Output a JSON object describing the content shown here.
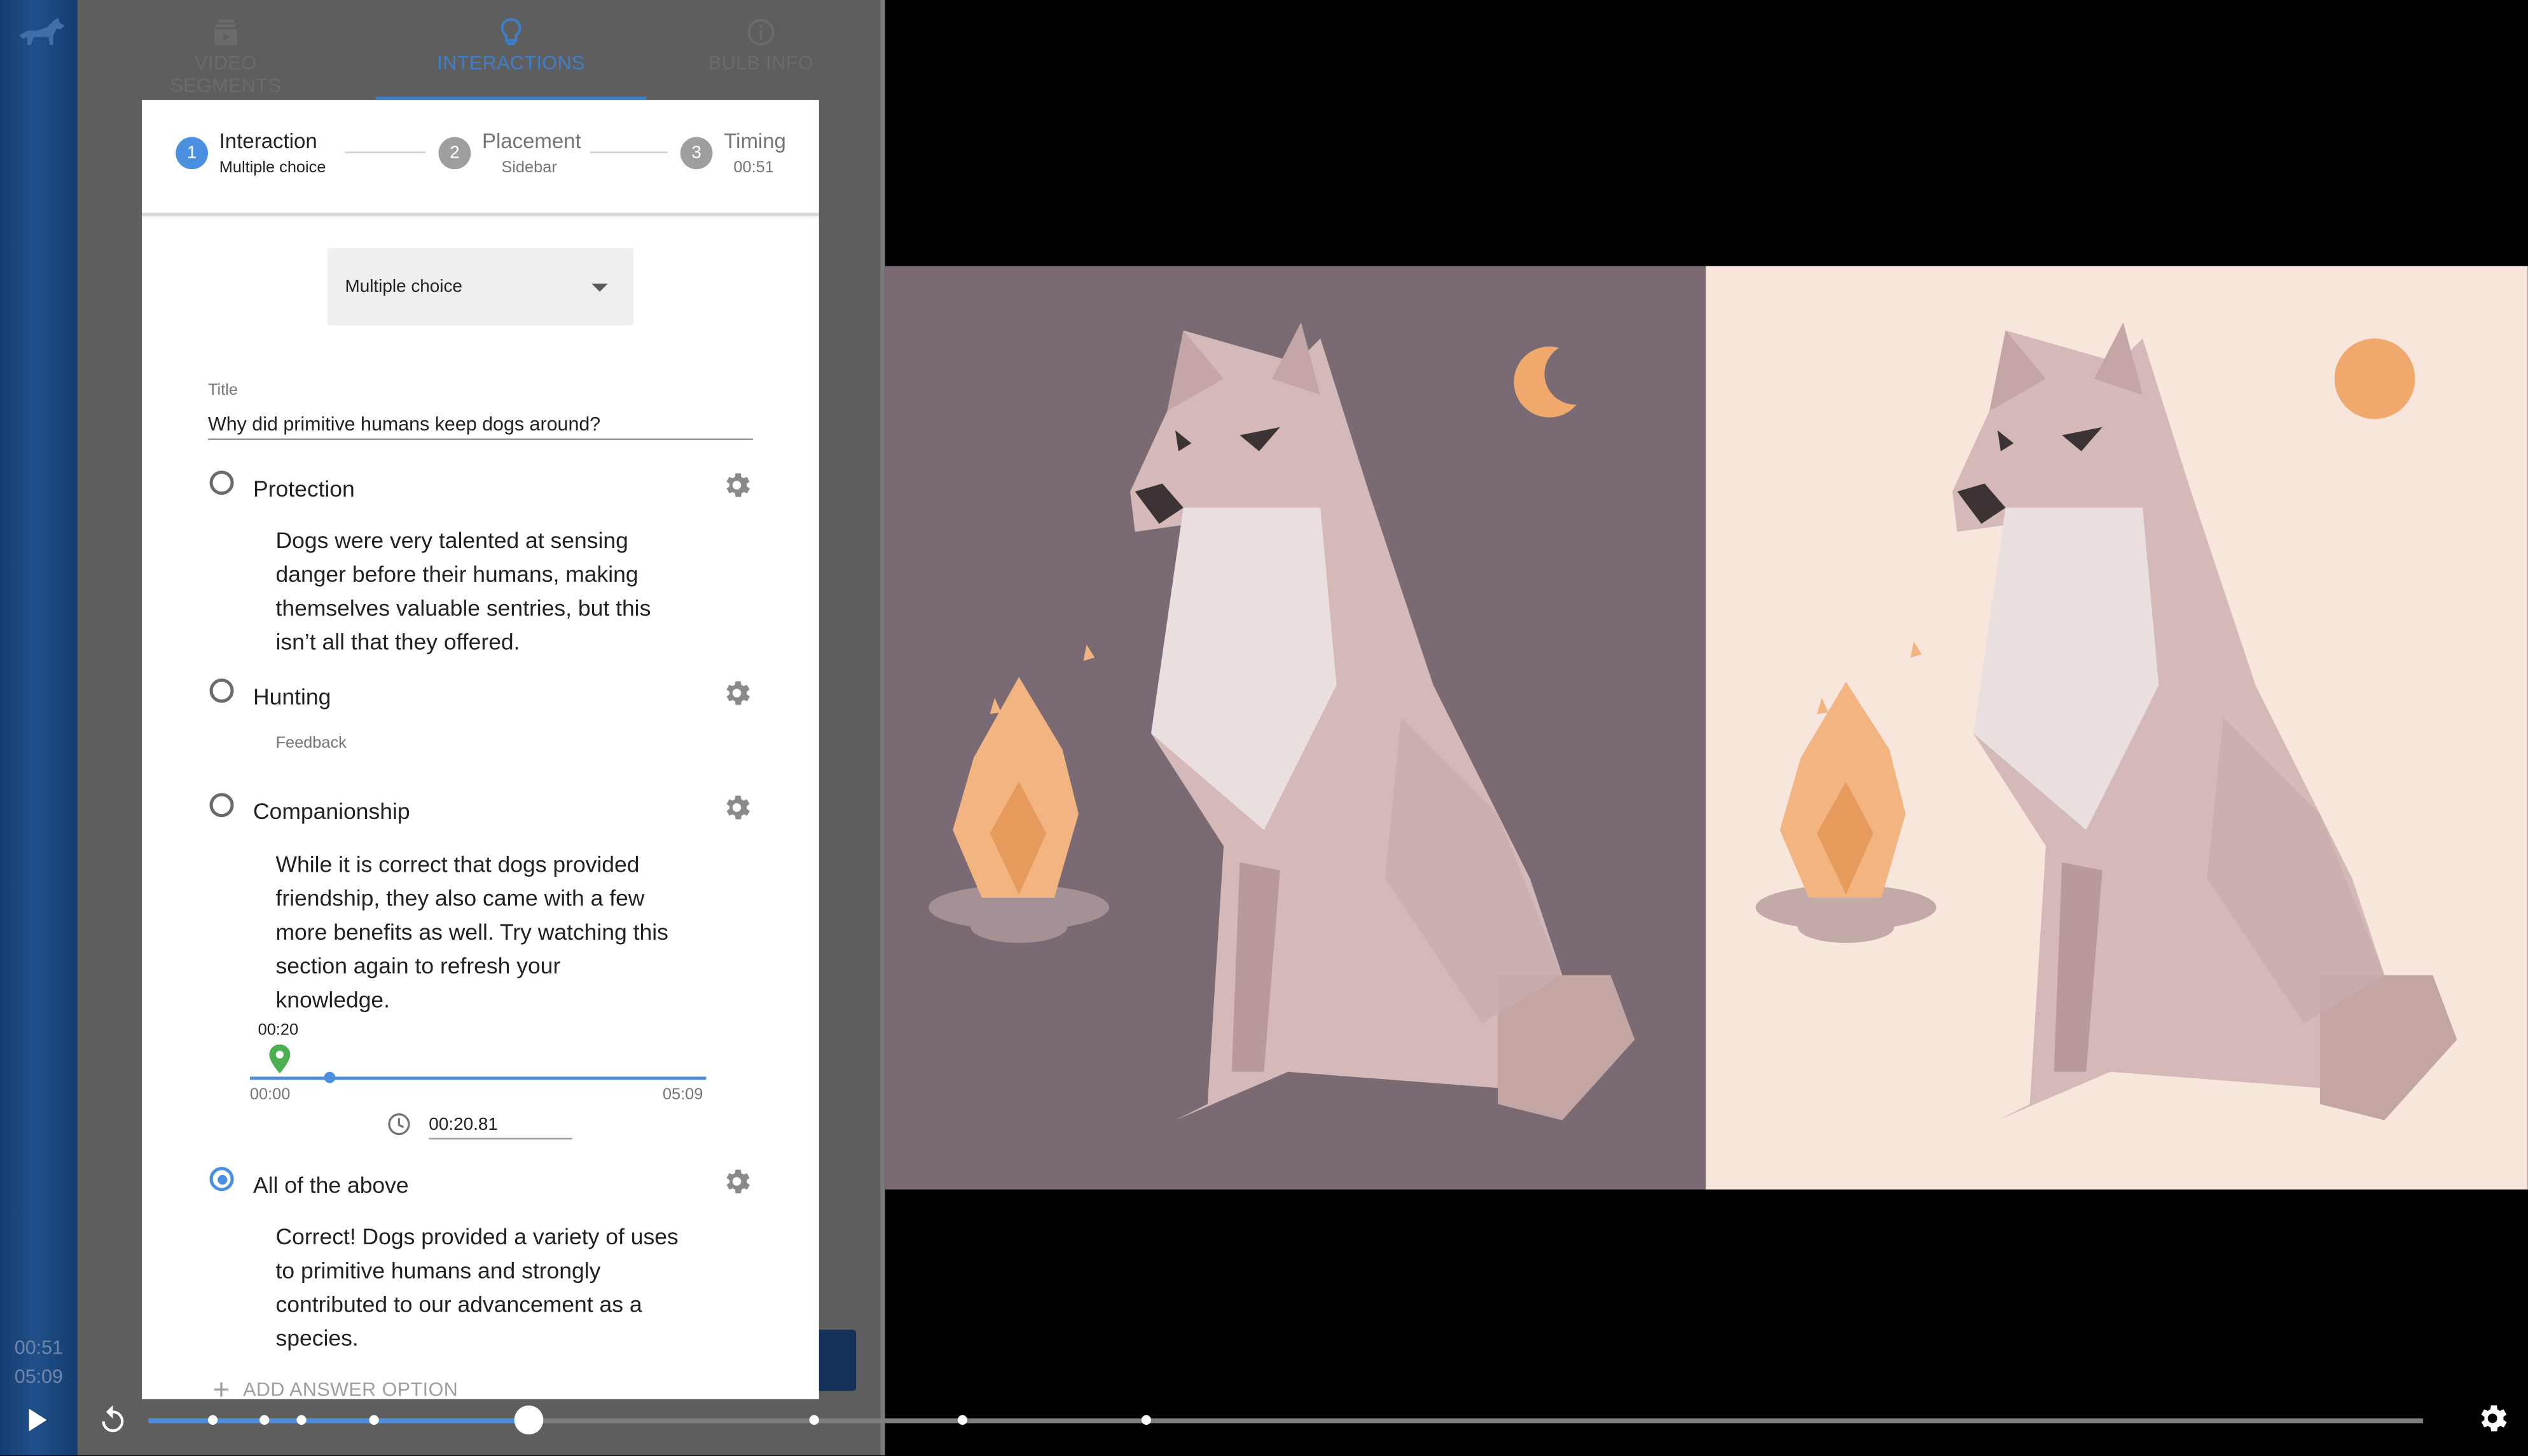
{
  "rail": {
    "time_current": "00:51",
    "time_total": "05:09"
  },
  "tabs": [
    {
      "label": "VIDEO SEGMENTS",
      "icon": "video-segments-icon"
    },
    {
      "label": "INTERACTIONS",
      "icon": "lightbulb-icon"
    },
    {
      "label": "BULB INFO",
      "icon": "info-icon"
    }
  ],
  "stepper": {
    "steps": [
      {
        "num": "1",
        "title": "Interaction",
        "sub": "Multiple choice"
      },
      {
        "num": "2",
        "title": "Placement",
        "sub": "Sidebar"
      },
      {
        "num": "3",
        "title": "Timing",
        "sub": "00:51"
      }
    ]
  },
  "form": {
    "type_select": "Multiple choice",
    "title_label": "Title",
    "title_value": "Why did primitive humans keep dogs around?",
    "options": [
      {
        "label": "Protection",
        "feedback": "Dogs were very talented at sensing danger before their humans, making themselves valuable sentries, but this isn’t all that they offered.",
        "selected": false
      },
      {
        "label": "Hunting",
        "feedback_placeholder": "Feedback",
        "selected": false
      },
      {
        "label": "Companionship",
        "feedback": "While it is correct that dogs provided friendship, they also came with a few more benefits as well. Try watching this section again to refresh your knowledge.",
        "selected": false
      },
      {
        "label": "All of the above",
        "feedback": "Correct! Dogs provided a variety of uses to primitive humans and strongly contributed to our advancement as a species.",
        "selected": true
      }
    ],
    "seek": {
      "pin_time": "00:20",
      "start": "00:00",
      "end": "05:09",
      "time_value": "00:20.81",
      "position_fraction": 0.06
    },
    "add_option": "ADD ANSWER OPTION"
  },
  "player": {
    "progress_fraction": 0.167,
    "marker_fractions": [
      0.028,
      0.051,
      0.067,
      0.099,
      0.293,
      0.358,
      0.439
    ]
  },
  "colors": {
    "accent": "#4a8fe0",
    "rail": "#1f4f8a",
    "pin": "#4caf50",
    "night_bg": "#7a6a74",
    "day_bg": "#f8e6dc"
  }
}
